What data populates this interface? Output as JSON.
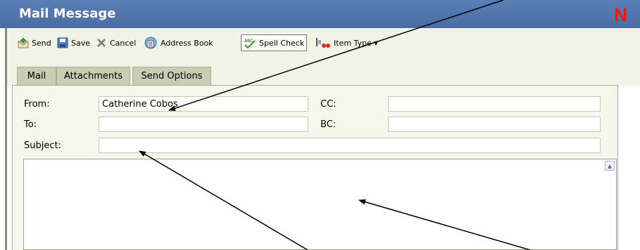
{
  "window": {
    "title": "Mail Message",
    "logo": "N",
    "colors": {
      "titlebar": "#4a6ca5",
      "logo": "#e41b17",
      "toolbar_bg": "#f1f3e6",
      "panel_bg": "#f5f7ec"
    }
  },
  "toolbar": {
    "items": [
      {
        "label": "Send",
        "icon": "send-icon"
      },
      {
        "label": "Save",
        "icon": "save-icon"
      },
      {
        "label": "Cancel",
        "icon": "cancel-icon"
      },
      {
        "label": "Address Book",
        "icon": "address-book-icon"
      },
      {
        "label": "Spell Check",
        "icon": "spell-check-icon"
      },
      {
        "label": "Item Type",
        "icon": "item-type-icon",
        "dropdown": true
      }
    ]
  },
  "tabs": [
    {
      "label": "Mail",
      "active": true
    },
    {
      "label": "Attachments",
      "active": false
    },
    {
      "label": "Send Options",
      "active": false
    }
  ],
  "form": {
    "from_label": "From:",
    "from_value": "Catherine Cobos",
    "to_label": "To:",
    "to_value": "",
    "subject_label": "Subject:",
    "subject_value": "",
    "cc_label": "CC:",
    "cc_value": "",
    "bc_label": "BC:",
    "bc_value": "",
    "body_value": ""
  },
  "annotations": {
    "arrow_count": 3,
    "color": "#000000"
  }
}
